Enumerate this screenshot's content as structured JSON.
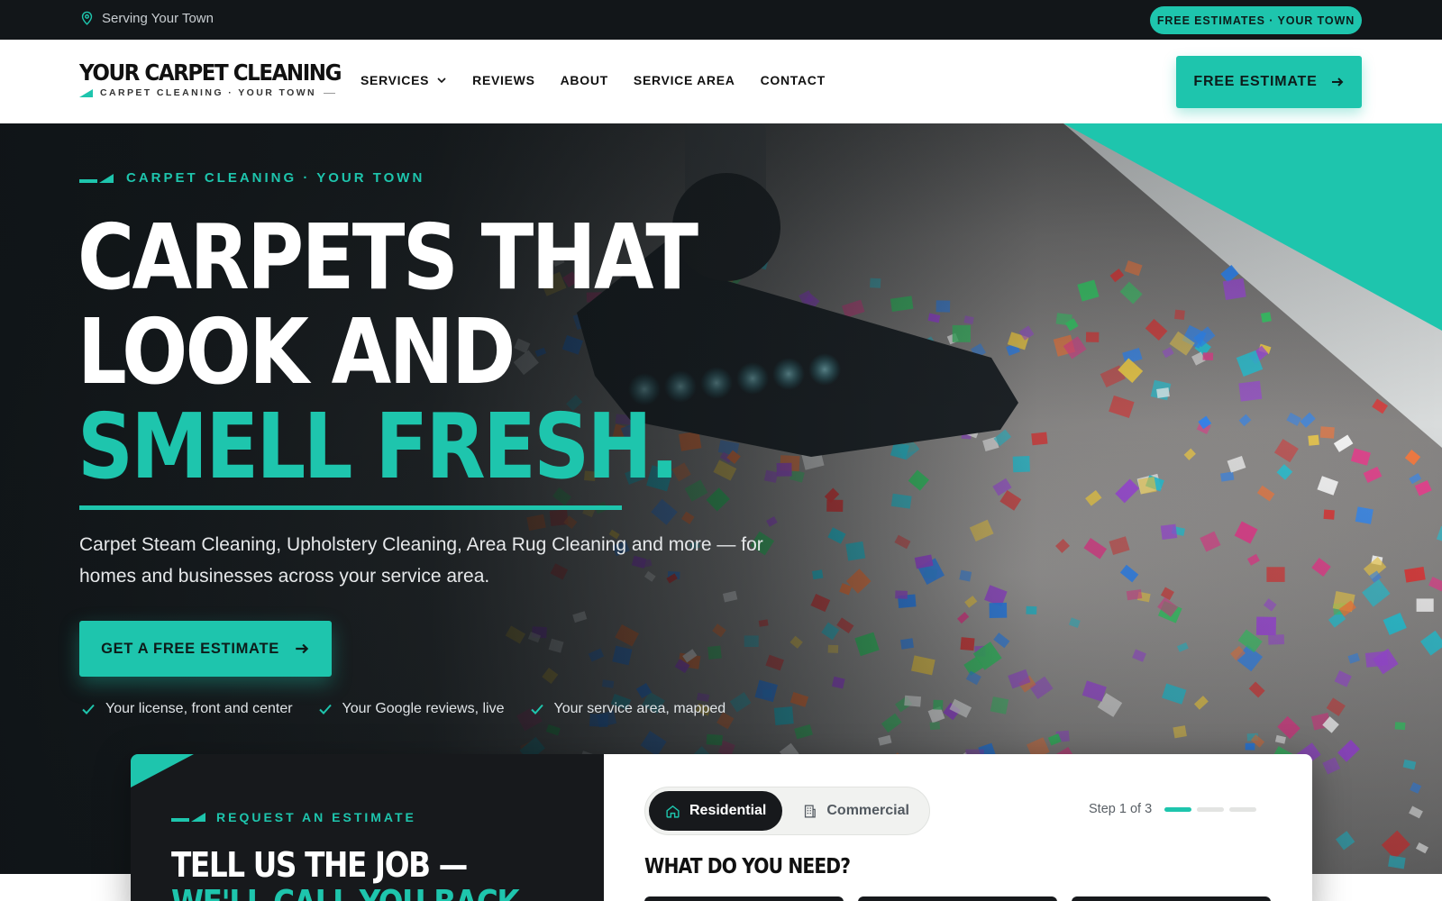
{
  "topbar": {
    "location": "Serving Your Town",
    "pill": "FREE ESTIMATES · YOUR TOWN"
  },
  "header": {
    "logo_main": "YOUR CARPET CLEANING",
    "logo_sub": "CARPET CLEANING · YOUR TOWN",
    "nav": [
      {
        "label": "SERVICES",
        "icon": "chevron-down-icon"
      },
      {
        "label": "REVIEWS"
      },
      {
        "label": "ABOUT"
      },
      {
        "label": "SERVICE AREA"
      },
      {
        "label": "CONTACT"
      }
    ],
    "cta": "FREE ESTIMATE"
  },
  "hero": {
    "eyebrow": "CARPET CLEANING · YOUR TOWN",
    "headline_line1": "CARPETS THAT",
    "headline_line2": "LOOK AND",
    "headline_accent": "SMELL FRESH.",
    "lede": "Carpet Steam Cleaning, Upholstery Cleaning, Area Rug Cleaning and more — for homes and businesses across your service area.",
    "cta": "GET A FREE ESTIMATE",
    "checks": [
      "Your license, front and center",
      "Your Google reviews, live",
      "Your service area, mapped"
    ]
  },
  "estimate_card": {
    "eyebrow": "REQUEST AN ESTIMATE",
    "title_line1": "TELL US THE JOB —",
    "title_line2": "WE'LL CALL YOU BACK",
    "tabs": [
      {
        "label": "Residential",
        "icon": "home-icon",
        "active": true
      },
      {
        "label": "Commercial",
        "icon": "building-icon",
        "active": false
      }
    ],
    "step_text": "Step 1 of 3",
    "step_current": 1,
    "step_total": 3,
    "question": "WHAT DO YOU NEED?"
  },
  "colors": {
    "accent": "#1ec5ad",
    "dark": "#121619",
    "white": "#ffffff"
  }
}
